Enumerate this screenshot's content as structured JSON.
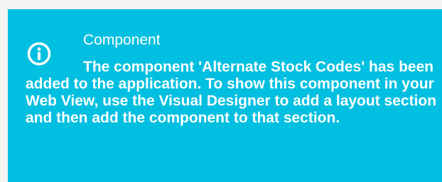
{
  "notification": {
    "icon": "info-icon",
    "background_color": "#00bfe0",
    "text_color": "#ffffff",
    "title": "Component",
    "message": "The component 'Alternate Stock Codes' has been added to the application. To show this component in your Web View, use the Visual Designer to add a layout section and then add the component to that section."
  }
}
